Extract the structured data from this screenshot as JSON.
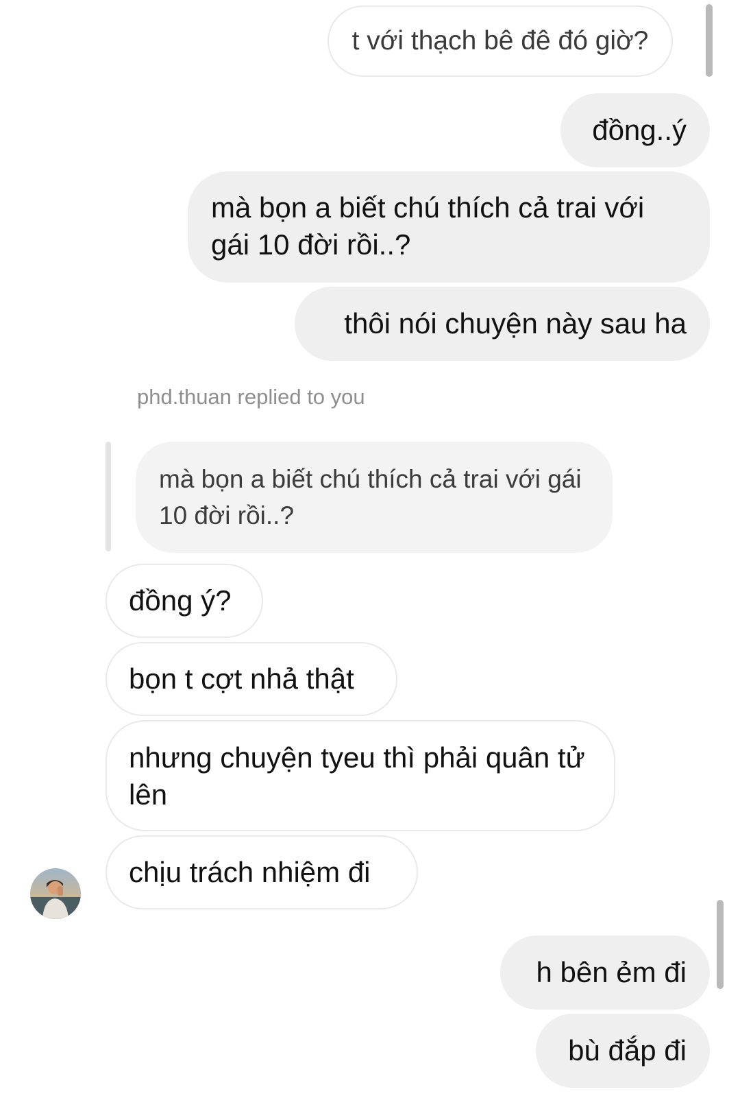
{
  "conversation": {
    "messages_top": [
      {
        "text": "t với thạch bê đê đó giờ?"
      },
      {
        "text": "đồng..ý"
      },
      {
        "text": "mà bọn a biết chú thích cả trai với gái 10 đời rồi..?"
      },
      {
        "text": "thôi nói chuyện này sau ha"
      }
    ],
    "reply": {
      "label": "phd.thuan replied to you",
      "quoted_text": "mà bọn a biết chú thích cả trai với gái 10 đời rồi..?"
    },
    "received": [
      {
        "text": "đồng ý?"
      },
      {
        "text": "bọn t cợt nhả thật"
      },
      {
        "text": "nhưng chuyện tyeu thì phải quân tử lên"
      },
      {
        "text": "chịu trách nhiệm đi"
      }
    ],
    "sent_bottom": [
      {
        "text": "h bên ẻm đi"
      },
      {
        "text": "bù đắp đi"
      }
    ],
    "avatar_icon": "user-avatar-photo"
  },
  "colors": {
    "sent_bubble": "#efefef",
    "received_border": "#e9e9e9",
    "reply_label": "#8e8e8e",
    "scrollbar": "#b9b9b9"
  }
}
